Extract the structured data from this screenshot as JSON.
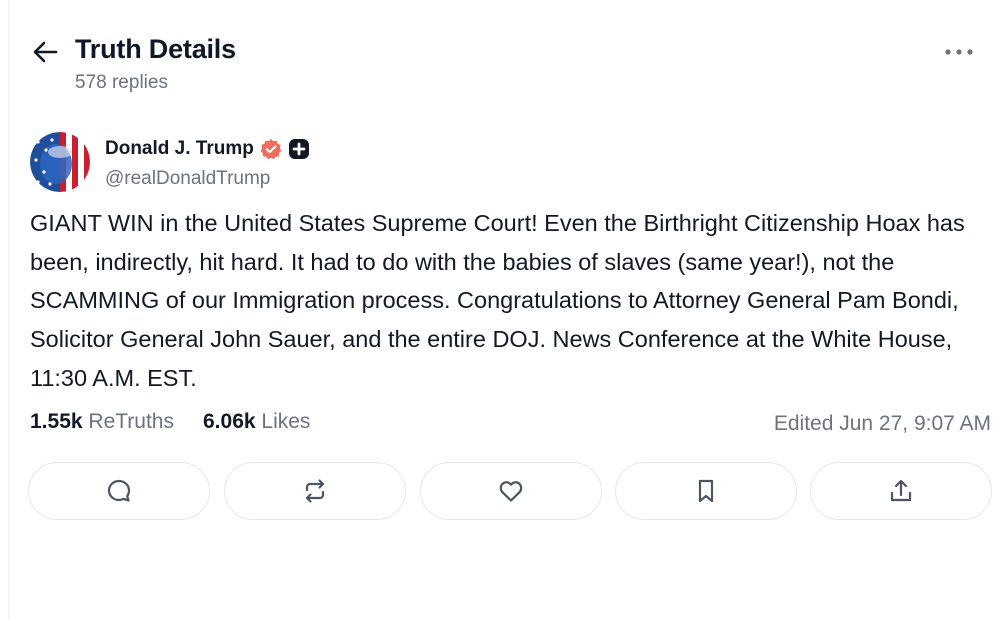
{
  "header": {
    "title": "Truth Details",
    "replies": "578 replies",
    "back_icon": "arrow-left-icon",
    "more_icon": "ellipsis-icon"
  },
  "post": {
    "author_name": "Donald J. Trump",
    "handle": "@realDonaldTrump",
    "verified_color": "#f26b5b",
    "text": "GIANT WIN in the United States Supreme Court! Even the Birthright Citizenship Hoax has been, indirectly, hit hard. It had to do with the babies of slaves (same year!), not the SCAMMING of our Immigration process. Congratulations to Attorney General Pam Bondi, Solicitor General John Sauer, and the entire DOJ. News Conference at the White House, 11:30 A.M. EST.",
    "stats": {
      "retruths_count": "1.55k",
      "retruths_label": "ReTruths",
      "likes_count": "6.06k",
      "likes_label": "Likes",
      "edited": "Edited Jun 27, 9:07 AM"
    }
  },
  "actions": [
    {
      "name": "reply",
      "icon": "comment-icon"
    },
    {
      "name": "retruth",
      "icon": "repost-icon"
    },
    {
      "name": "like",
      "icon": "heart-icon"
    },
    {
      "name": "bookmark",
      "icon": "bookmark-icon"
    },
    {
      "name": "share",
      "icon": "share-icon"
    }
  ],
  "colors": {
    "text": "#111827",
    "muted": "#6b7280",
    "border": "#e5e7eb",
    "icon": "#4b5563"
  }
}
